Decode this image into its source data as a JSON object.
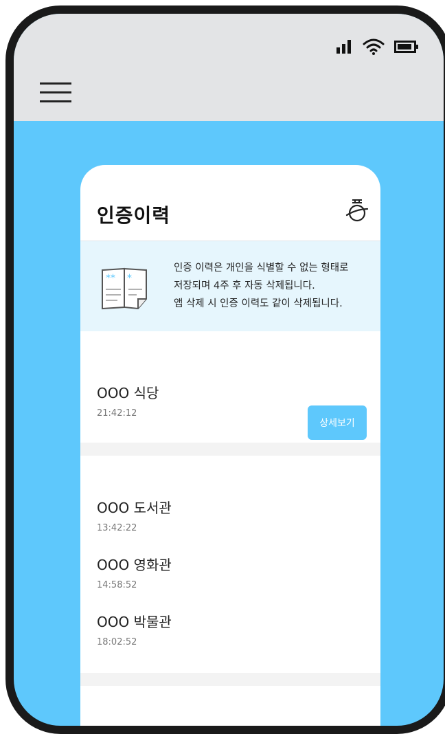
{
  "header": {
    "menu_icon": "hamburger-menu-icon",
    "status_icons": [
      "signal-icon",
      "wifi-icon",
      "battery-icon"
    ]
  },
  "card": {
    "title": "인증이력",
    "action_icon": "planet-icon",
    "notice": {
      "icon": "open-book-icon",
      "lines": [
        "인증 이력은 개인을 식별할 수 없는 형태로",
        "저장되며 4주 후 자동 삭제됩니다.",
        "앱 삭제 시 인증 이력도 같이 삭제됩니다."
      ]
    },
    "groups": [
      {
        "items": [
          {
            "name": "OOO 식당",
            "time": "21:42:12",
            "button_label": "상세보기"
          }
        ]
      },
      {
        "items": [
          {
            "name": "OOO 도서관",
            "time": "13:42:22"
          },
          {
            "name": "OOO 영화관",
            "time": "14:58:52"
          },
          {
            "name": "OOO 박물관",
            "time": "18:02:52"
          }
        ]
      }
    ]
  },
  "colors": {
    "accent": "#5ec8fc",
    "header_bg": "#e3e4e6",
    "notice_bg": "#e6f6fd",
    "frame": "#1a1a1a"
  }
}
